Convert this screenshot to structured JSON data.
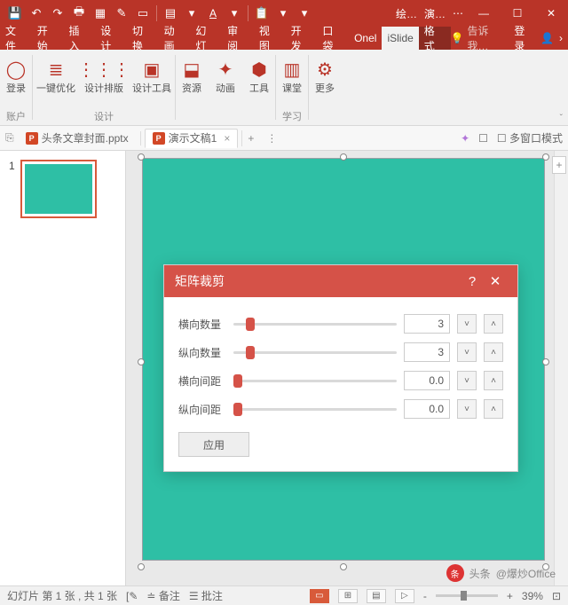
{
  "titlebar": {
    "context": "绘…",
    "doc": "演…"
  },
  "qat_icons": [
    "save",
    "undo",
    "redo",
    "print",
    "table",
    "picker",
    "preview",
    "new",
    "text",
    "fontcolor",
    "more1",
    "copy",
    "more2",
    "more3"
  ],
  "ribbon_tabs": [
    "文件",
    "开始",
    "插入",
    "设计",
    "切换",
    "动画",
    "幻灯",
    "审阅",
    "视图",
    "开发",
    "口袋",
    "Onel",
    "iSlide",
    "格式"
  ],
  "ribbon_active": "iSlide",
  "tellme": "告诉我…",
  "login": "登录",
  "ribbon_groups": {
    "account": {
      "label": "账户",
      "items": [
        {
          "key": "login",
          "label": "登录"
        }
      ]
    },
    "design": {
      "label": "设计",
      "items": [
        {
          "key": "opt",
          "label": "一键优化"
        },
        {
          "key": "layout",
          "label": "设计排版"
        },
        {
          "key": "tool",
          "label": "设计工具"
        }
      ]
    },
    "misc": {
      "label": "",
      "items": [
        {
          "key": "res",
          "label": "资源"
        },
        {
          "key": "anim",
          "label": "动画"
        },
        {
          "key": "util",
          "label": "工具"
        }
      ]
    },
    "learn": {
      "label": "学习",
      "items": [
        {
          "key": "class",
          "label": "课堂"
        }
      ]
    },
    "more": {
      "label": "",
      "items": [
        {
          "key": "more",
          "label": "更多"
        }
      ]
    }
  },
  "doc_tabs": [
    {
      "name": "头条文章封面.pptx",
      "active": false
    },
    {
      "name": "演示文稿1",
      "active": true
    }
  ],
  "multiwin": "多窗口模式",
  "thumb": {
    "num": "1"
  },
  "dialog": {
    "title": "矩阵裁剪",
    "rows": [
      {
        "label": "横向数量",
        "value": "3",
        "knob": 14
      },
      {
        "label": "纵向数量",
        "value": "3",
        "knob": 14
      },
      {
        "label": "横向间距",
        "value": "0.0",
        "knob": 0
      },
      {
        "label": "纵向间距",
        "value": "0.0",
        "knob": 0
      }
    ],
    "apply": "应用"
  },
  "status": {
    "slide": "幻灯片 第 1 张 , 共 1 张",
    "notes": "备注",
    "comments": "批注",
    "zoom": "39%",
    "minus": "-",
    "plus": "+"
  },
  "watermark": {
    "prefix": "头条",
    "author": "@爆炒Office"
  }
}
